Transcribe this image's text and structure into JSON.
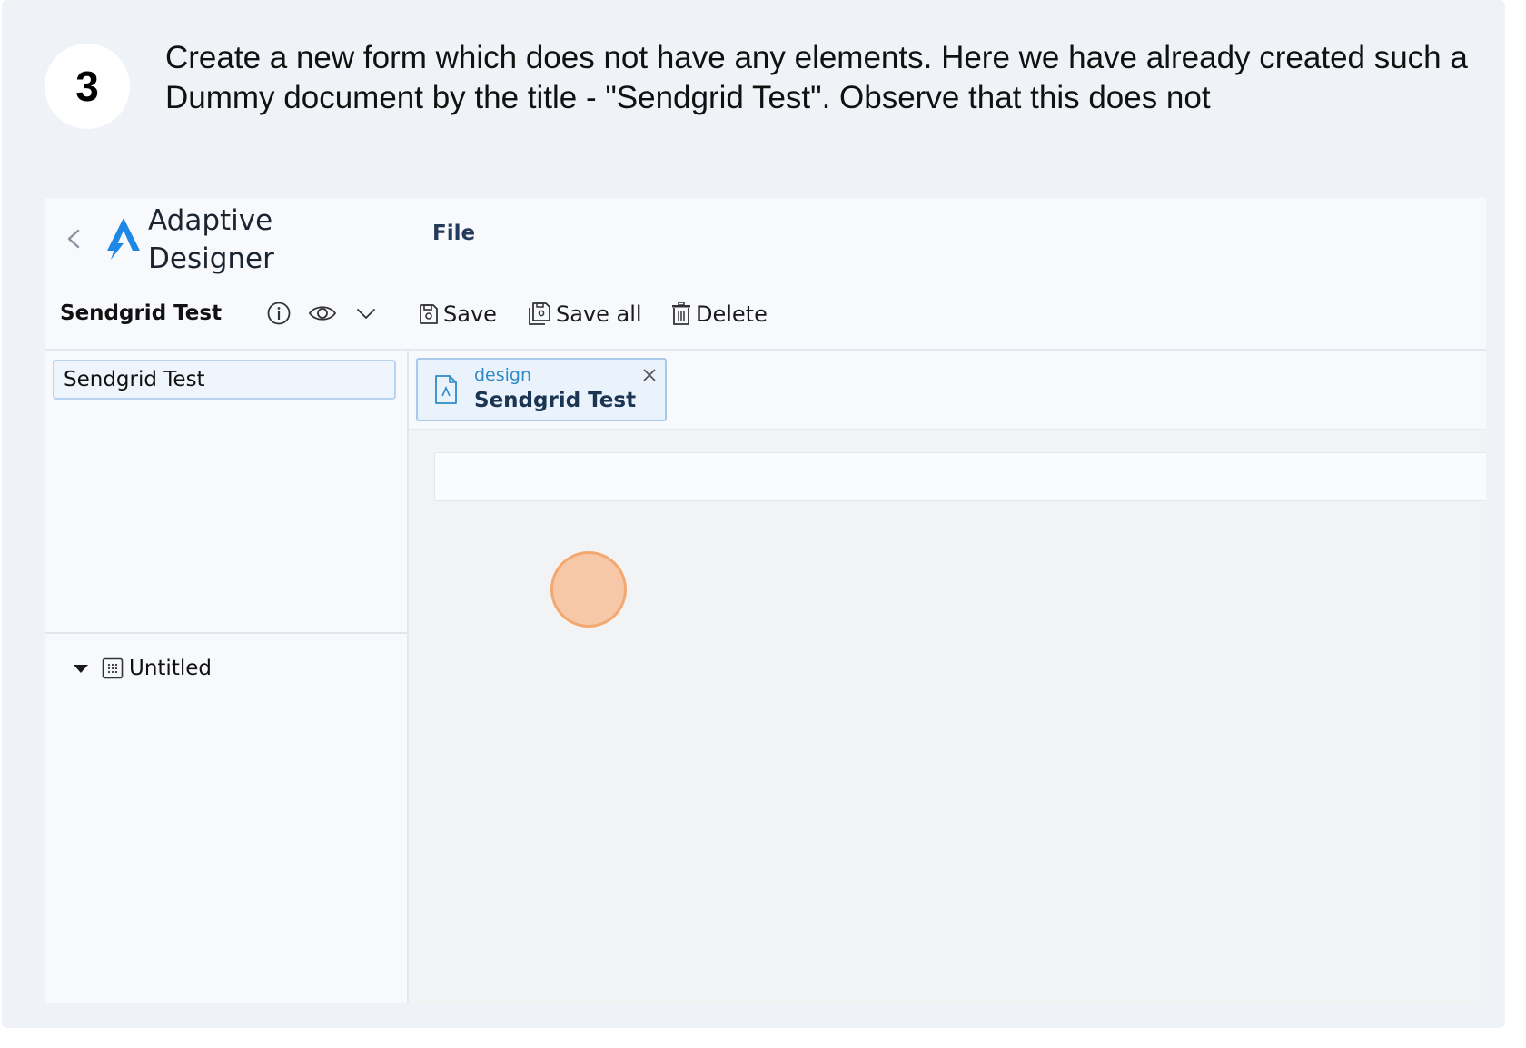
{
  "step": {
    "number": "3",
    "text": "Create a new form which does not have any elements. Here we have already created such a Dummy document by the title - \"Sendgrid Test\". Observe that this does not"
  },
  "app": {
    "title_line1": "Adaptive",
    "title_line2": "Designer",
    "menu": {
      "file": "File"
    },
    "brand_color": "#1e88e5"
  },
  "toolbar": {
    "document_title": "Sendgrid Test",
    "info_icon": "info-icon",
    "preview_icon": "eye-icon",
    "dropdown_icon": "chevron-down-icon",
    "save_label": "Save",
    "save_all_label": "Save all",
    "delete_label": "Delete"
  },
  "left_panel": {
    "search_value": "Sendgrid Test",
    "tree": [
      {
        "label": "Untitled",
        "expanded": true
      }
    ]
  },
  "tabs": [
    {
      "kind": "design",
      "name": "Sendgrid Test",
      "active": true
    }
  ]
}
